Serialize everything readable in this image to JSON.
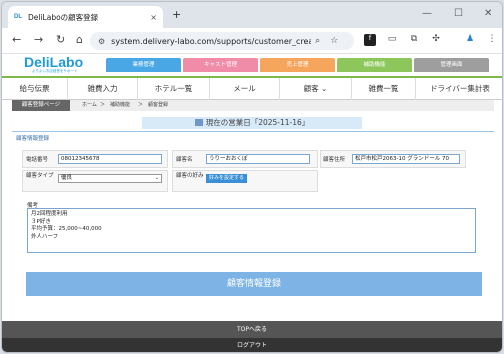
{
  "browser": {
    "tab_favicon": "DL",
    "tab_title": "DeliLaboの顧客登録",
    "tab_close": "×",
    "new_tab": "+",
    "window_controls": [
      "—",
      "☐",
      "✕"
    ],
    "url": "system.delivery-labo.com/supports/customer_crea...",
    "icons": [
      "back-icon",
      "forward-icon",
      "reload-icon",
      "home-icon",
      "site-info-icon",
      "zoom-icon",
      "bookmark-star-icon",
      "extension-f-icon",
      "extension-chat-icon",
      "extension-box-icon",
      "extensions-puzzle-icon",
      "profile-icon",
      "menu-icon"
    ]
  },
  "site": {
    "logo": "DeliLabo",
    "logo_sub": "よりよいお店経営をサポート",
    "top_nav": [
      {
        "label": "業務管理",
        "color": "#4aa7e6"
      },
      {
        "label": "キャスト管理",
        "color": "#f08ba8"
      },
      {
        "label": "売上管理",
        "color": "#f6a55c"
      },
      {
        "label": "補助機能",
        "color": "#8dc65b"
      },
      {
        "label": "管理画面",
        "color": "#9e9e9e"
      }
    ],
    "main_nav": [
      "給与伝票",
      "雑費入力",
      "ホテル一覧",
      "メール",
      "顧客 ⌄",
      "雑費一覧",
      "ドライバー集計表"
    ]
  },
  "breadcrumb": {
    "page": "顧客登録ページ",
    "items": [
      "ホーム",
      "＞",
      "補助機能",
      "＞",
      "顧客登録"
    ]
  },
  "business_date": "現在の営業日「2025-11-16」",
  "form": {
    "section_title": "顧客情報登録",
    "phone_label": "電話番号",
    "phone_value": "08012345678",
    "name_label": "顧客名",
    "name_value": "うりーおおくぼ",
    "address_label": "顧客住所",
    "address_value": "松戸市松戸2063-10 グランドール 70",
    "type_label": "顧客タイプ",
    "type_value": "優良",
    "preference_label": "顧客の好み",
    "preference_button": "好みを設定する",
    "remarks_label": "備考",
    "remarks_lines": [
      "月2回程度利用",
      "３P好き",
      "平均予算：25,000~40,000",
      "外人ハーフ"
    ],
    "submit_label": "顧客情報登録"
  },
  "footer": {
    "top_link": "TOPへ戻る",
    "logout": "ログアウト"
  }
}
